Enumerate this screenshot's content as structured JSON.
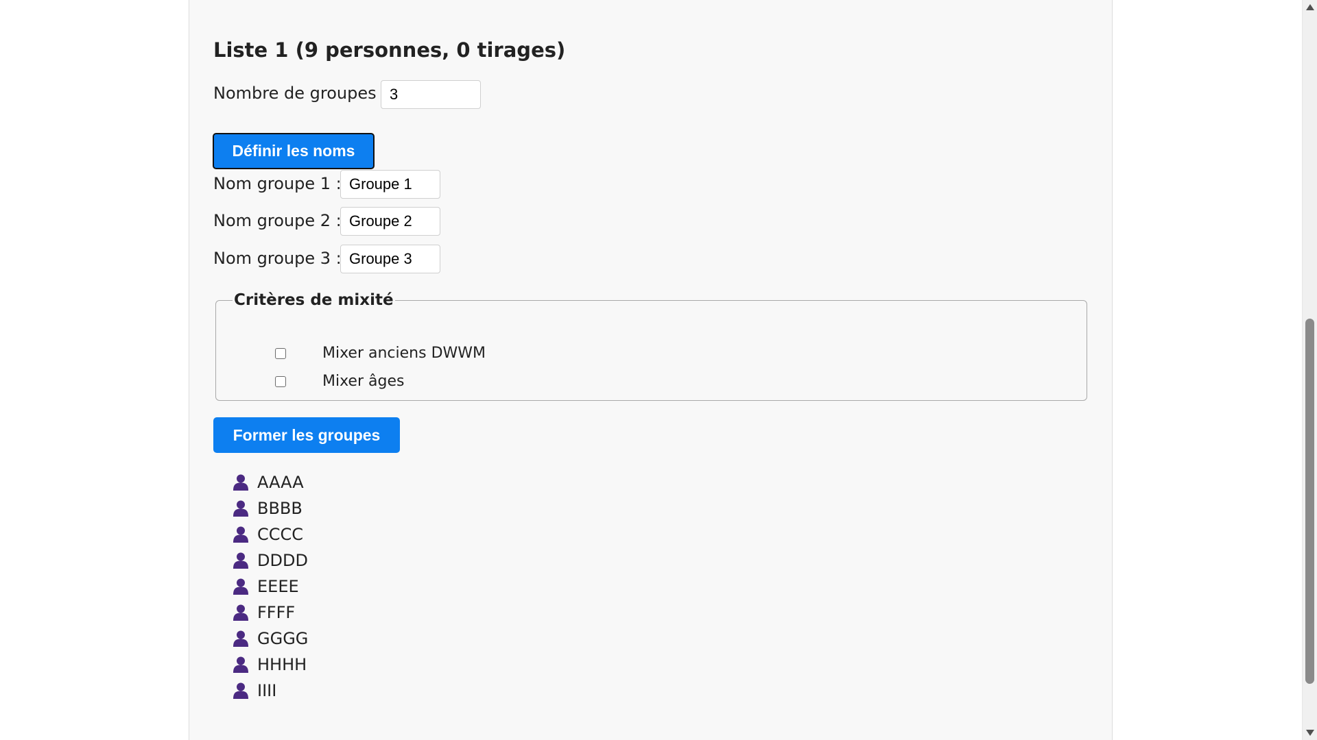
{
  "list": {
    "title": "Liste 1 (9 personnes, 0 tirages)"
  },
  "groups_count": {
    "label": "Nombre de groupes :",
    "value": "3"
  },
  "define_names_button": {
    "label": "Définir les noms"
  },
  "group_names": [
    {
      "label": "Nom groupe 1 :",
      "value": "Groupe 1"
    },
    {
      "label": "Nom groupe 2 :",
      "value": "Groupe 2"
    },
    {
      "label": "Nom groupe 3 :",
      "value": "Groupe 3"
    }
  ],
  "mix_criteria": {
    "legend": "Critères de mixité",
    "options": [
      {
        "label": "Mixer anciens DWWM",
        "checked": false
      },
      {
        "label": "Mixer âges",
        "checked": false
      }
    ]
  },
  "form_groups_button": {
    "label": "Former les groupes"
  },
  "people": {
    "icon": "person-icon",
    "icon_color": "#4b2a82",
    "names": [
      "AAAA",
      "BBBB",
      "CCCC",
      "DDDD",
      "EEEE",
      "FFFF",
      "GGGG",
      "HHHH",
      "IIII"
    ]
  },
  "colors": {
    "primary": "#0d7ff0",
    "card_background": "#f8f8f8"
  }
}
